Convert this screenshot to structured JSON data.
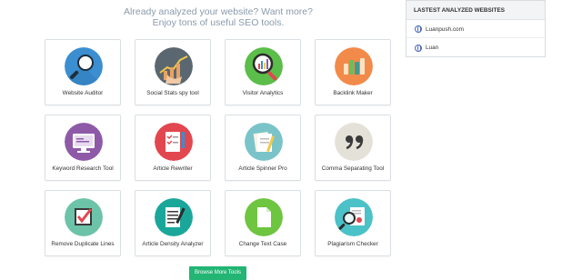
{
  "headline": {
    "line1": "Already analyzed your website? Want more?",
    "line2": "Enjoy tons of useful SEO tools."
  },
  "tools": [
    {
      "label": "Website Auditor",
      "icon": "magnifier-icon",
      "color": "#3b8ed0"
    },
    {
      "label": "Social Stats spy tool",
      "icon": "growth-chart-hand-icon",
      "color": "#5b6770"
    },
    {
      "label": "Visitor Analytics",
      "icon": "magnifier-chart-icon",
      "color": "#5bbd4a"
    },
    {
      "label": "Backlink Maker",
      "icon": "bar-stack-icon",
      "color": "#f28a4a"
    },
    {
      "label": "Keyword Research Tool",
      "icon": "monitor-icon",
      "color": "#8e5aa8"
    },
    {
      "label": "Article Rewriter",
      "icon": "checklist-icon",
      "color": "#e2474f"
    },
    {
      "label": "Article Spinner Pro",
      "icon": "papers-pencil-icon",
      "color": "#7ac4c9"
    },
    {
      "label": "Comma Separating Tool",
      "icon": "quote-icon",
      "color": "#e4e2d8"
    },
    {
      "label": "Remove Duplicate Lines",
      "icon": "checkbox-icon",
      "color": "#6cc3a8"
    },
    {
      "label": "Article Density Analyzer",
      "icon": "document-pen-icon",
      "color": "#1aa79a"
    },
    {
      "label": "Change Text Case",
      "icon": "page-icon",
      "color": "#6ec53f"
    },
    {
      "label": "Plagiarism Checker",
      "icon": "magnifier-report-icon",
      "color": "#4bc1c8"
    }
  ],
  "browse_button": "Browse More Tools",
  "side_panel": {
    "title": "LASTEST ANALYZED WEBSITES",
    "sites": [
      {
        "label": "Luanpush.com"
      },
      {
        "label": "Luan"
      }
    ]
  },
  "accent": "#22b573"
}
